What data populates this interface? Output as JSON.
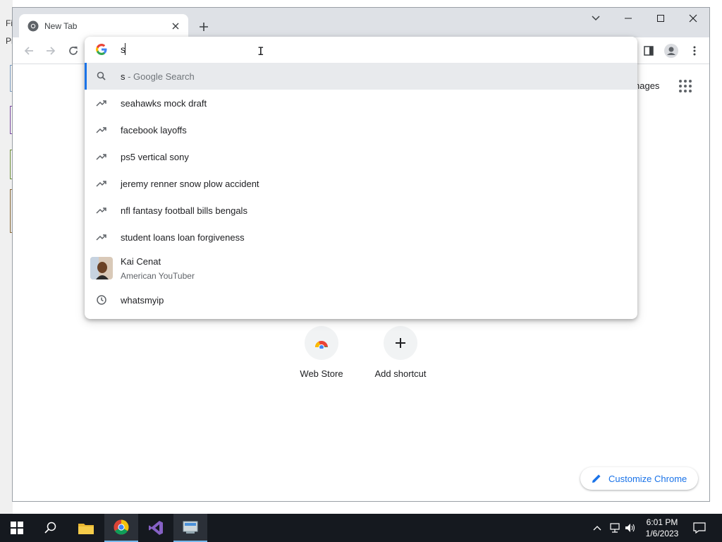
{
  "background": {
    "left_text_1": "Fi",
    "left_text_2": "Pr"
  },
  "browser": {
    "tab": {
      "title": "New Tab"
    },
    "window_controls": [
      "tab-search",
      "minimize",
      "maximize",
      "close"
    ]
  },
  "omnibox": {
    "input_value": "s",
    "suggestions": [
      {
        "icon": "search-icon",
        "text": "s",
        "suffix": " - Google Search",
        "selected": true
      },
      {
        "icon": "trending-icon",
        "text": "seahawks mock draft"
      },
      {
        "icon": "trending-icon",
        "text": "facebook layoffs"
      },
      {
        "icon": "trending-icon",
        "text": "ps5 vertical sony"
      },
      {
        "icon": "trending-icon",
        "text": "jeremy renner snow plow accident"
      },
      {
        "icon": "trending-icon",
        "text": "nfl fantasy football bills bengals"
      },
      {
        "icon": "trending-icon",
        "text": "student loans loan forgiveness"
      }
    ],
    "entity": {
      "title": "Kai Cenat",
      "subtitle": "American YouTuber"
    },
    "history": {
      "icon": "history-icon",
      "text": "whatsmyip"
    }
  },
  "ntp": {
    "images_label": "nages",
    "shortcuts": [
      {
        "label": "Web Store",
        "icon": "web-store-icon"
      },
      {
        "label": "Add shortcut",
        "icon": "plus-icon"
      }
    ],
    "customize_label": "Customize Chrome"
  },
  "taskbar": {
    "apps": [
      "start",
      "search",
      "file-explorer",
      "chrome",
      "visual-studio",
      "app"
    ],
    "clock": {
      "time": "6:01 PM",
      "date": "1/6/2023"
    }
  },
  "colors": {
    "accent": "#1a73e8",
    "titlebar": "#dee1e6",
    "taskbar": "#15191f"
  }
}
